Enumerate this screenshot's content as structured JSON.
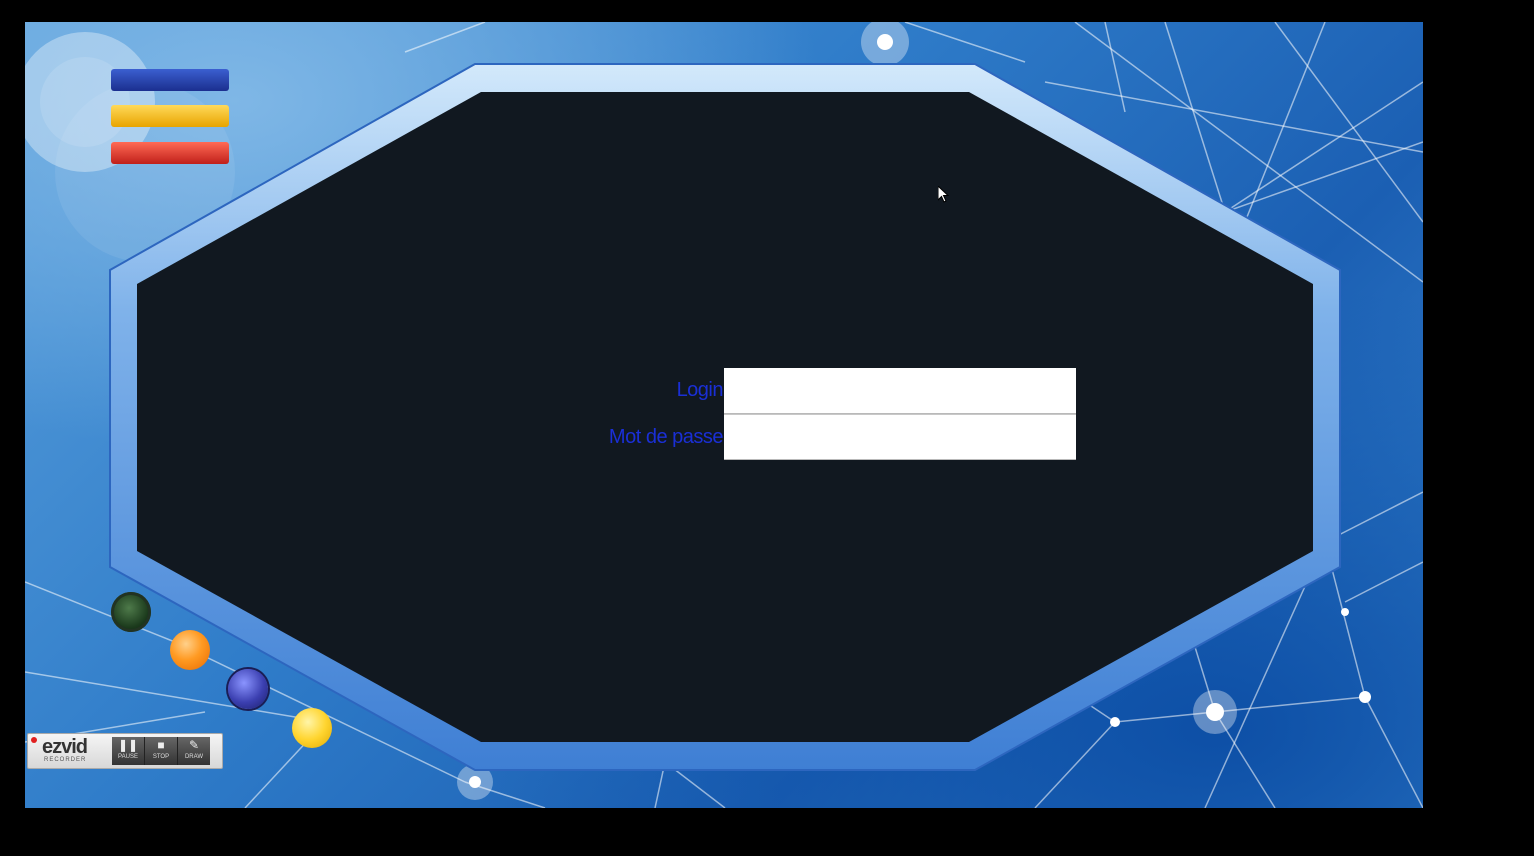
{
  "login_form": {
    "login_label": "Login",
    "login_value": "",
    "password_label": "Mot de passe",
    "password_value": ""
  },
  "recorder": {
    "logo": "ezvid",
    "sub": "RECORDER",
    "buttons": [
      {
        "label": "PAUSE",
        "icon": "pause-icon"
      },
      {
        "label": "STOP",
        "icon": "stop-icon"
      },
      {
        "label": "DRAW",
        "icon": "draw-icon"
      }
    ]
  },
  "colors": {
    "label_text": "#1a2fd6",
    "panel_fill": "#111820",
    "frame_blue": "#4b86d6",
    "bar_blue": "#1b2f8f",
    "bar_yellow": "#e8a400",
    "bar_red": "#c0201a"
  }
}
